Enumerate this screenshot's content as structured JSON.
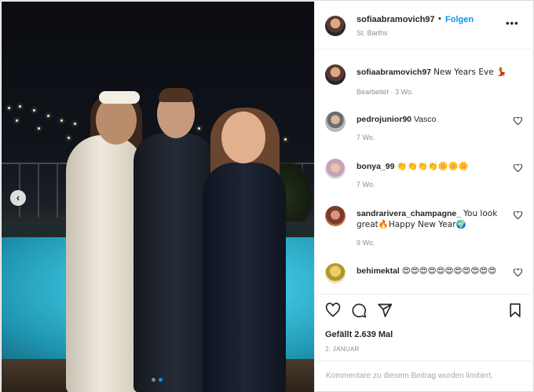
{
  "post": {
    "username": "sofiaabramovich97",
    "follow_label": "Folgen",
    "separator": "•",
    "location": "St. Barths",
    "more_icon": "more-options-icon",
    "more_glyph": "•••"
  },
  "caption": {
    "username": "sofiaabramovich97",
    "text": "New Years Eve 💃",
    "meta": "Bearbeitet · 3 Wo."
  },
  "comments": [
    {
      "username": "pedrojunior90",
      "text": "Vasco",
      "meta": "7 Wo."
    },
    {
      "username": "bonya_99",
      "text": "👏👏👏👏🌼🌼🌼",
      "meta": "7 Wo."
    },
    {
      "username": "sandrarivera_champagne_",
      "text": "You look great🔥Happy New Year🌍",
      "meta": "9 Wo."
    },
    {
      "username": "behimektal",
      "text": "😍😍😍😍😍😍😍😍😍😍😍",
      "meta": ""
    }
  ],
  "actions": {
    "likes": "Gefällt 2.639 Mal",
    "date": "2. JANUAR"
  },
  "footer": {
    "limited_text": "Kommentare zu diesem Beitrag wurden limitiert."
  },
  "carousel": {
    "prev_glyph": "‹",
    "active_index": 1,
    "total": 2
  },
  "colors": {
    "accent": "#0095f6",
    "muted": "#8e8e8e",
    "text": "#262626"
  }
}
